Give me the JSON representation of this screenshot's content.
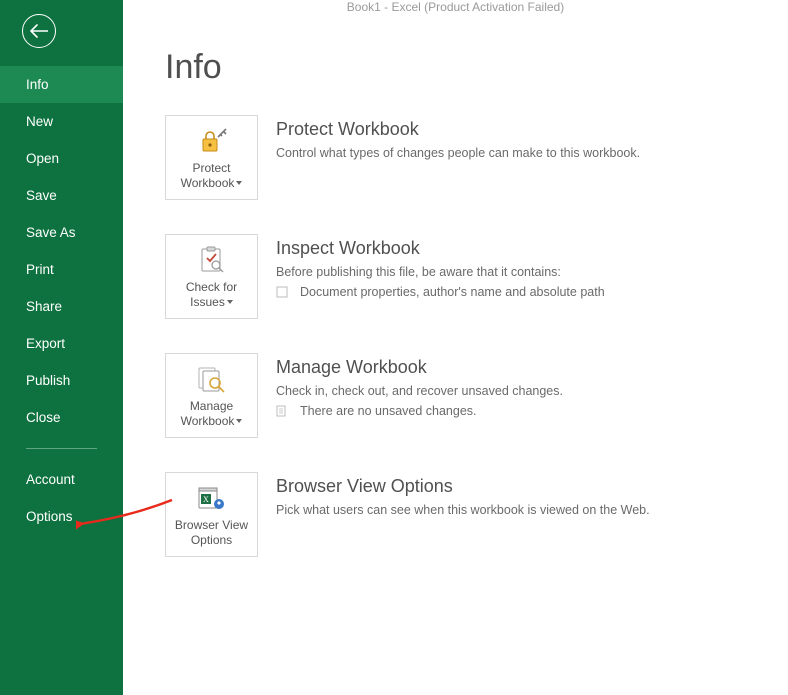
{
  "title_bar": "Book1 - Excel (Product Activation Failed)",
  "nav": {
    "items": [
      "Info",
      "New",
      "Open",
      "Save",
      "Save As",
      "Print",
      "Share",
      "Export",
      "Publish",
      "Close"
    ],
    "footer_items": [
      "Account",
      "Options"
    ],
    "active_index": 0
  },
  "page": {
    "heading": "Info"
  },
  "sections": {
    "protect": {
      "button": "Protect Workbook",
      "heading": "Protect Workbook",
      "desc": "Control what types of changes people can make to this workbook."
    },
    "inspect": {
      "button": "Check for Issues",
      "heading": "Inspect Workbook",
      "desc": "Before publishing this file, be aware that it contains:",
      "bullet": "Document properties, author's name and absolute path"
    },
    "manage": {
      "button": "Manage Workbook",
      "heading": "Manage Workbook",
      "desc": "Check in, check out, and recover unsaved changes.",
      "bullet": "There are no unsaved changes."
    },
    "browser": {
      "button": "Browser View Options",
      "heading": "Browser View Options",
      "desc": "Pick what users can see when this workbook is viewed on the Web."
    }
  }
}
